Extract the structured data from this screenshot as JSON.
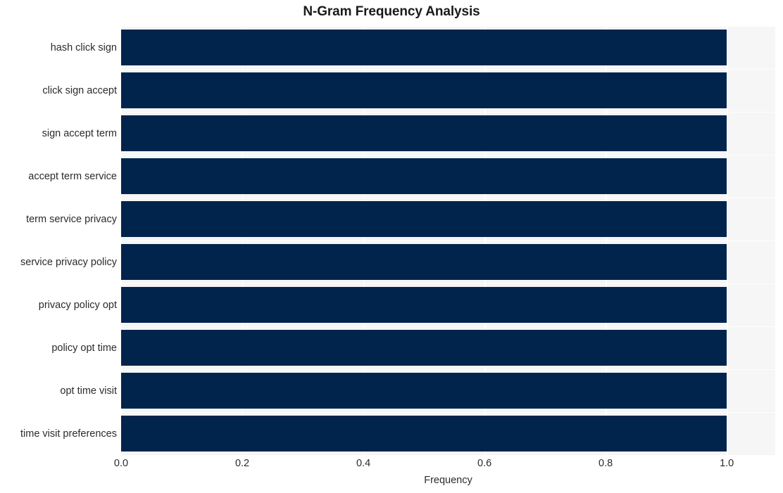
{
  "chart_data": {
    "type": "bar",
    "orientation": "horizontal",
    "title": "N-Gram Frequency Analysis",
    "xlabel": "Frequency",
    "ylabel": "",
    "categories": [
      "hash click sign",
      "click sign accept",
      "sign accept term",
      "accept term service",
      "term service privacy",
      "service privacy policy",
      "privacy policy opt",
      "policy opt time",
      "opt time visit",
      "time visit preferences"
    ],
    "values": [
      1.0,
      1.0,
      1.0,
      1.0,
      1.0,
      1.0,
      1.0,
      1.0,
      1.0,
      1.0
    ],
    "xlim": [
      0.0,
      1.08
    ],
    "xticks": [
      0.0,
      0.2,
      0.4,
      0.6,
      0.8,
      1.0
    ],
    "xtick_labels": [
      "0.0",
      "0.2",
      "0.4",
      "0.6",
      "0.8",
      "1.0"
    ],
    "grid": true,
    "legend": null,
    "bar_color": "#00244c",
    "plot_background": "#f6f6f7",
    "figure_background": "#ffffff",
    "gridline_color": "#ffffff"
  }
}
